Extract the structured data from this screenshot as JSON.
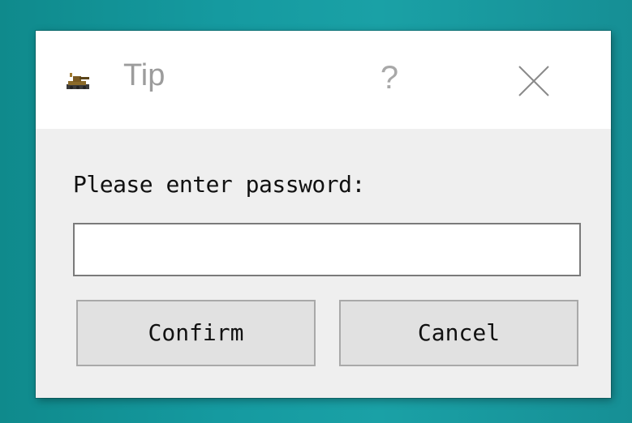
{
  "window": {
    "title": "Tip",
    "help_label": "?",
    "icon": "app-tank-icon",
    "close_icon": "close-icon"
  },
  "content": {
    "prompt": "Please enter password:",
    "password_value": "",
    "password_placeholder": ""
  },
  "buttons": {
    "confirm_label": "Confirm",
    "cancel_label": "Cancel"
  },
  "colors": {
    "desktop_background": "#159aa0",
    "dialog_background": "#efefef",
    "titlebar_background": "#ffffff",
    "title_text": "#9c9c9c",
    "button_background": "#e1e1e1"
  }
}
